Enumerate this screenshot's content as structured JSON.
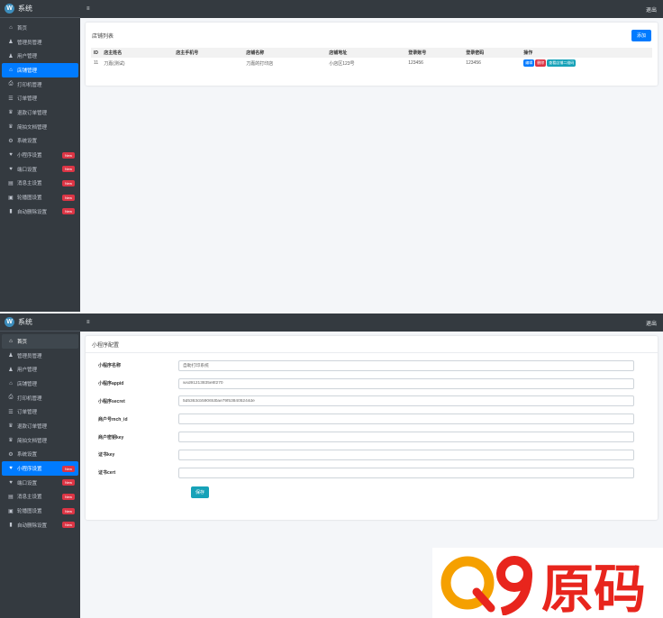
{
  "brand": "系统",
  "logout": "退出",
  "top": {
    "nav": [
      {
        "icon": "⌂",
        "label": "首页"
      },
      {
        "icon": "♟",
        "label": "管理员管理"
      },
      {
        "icon": "♟",
        "label": "用户管理"
      },
      {
        "icon": "⌂",
        "label": "店铺管理",
        "active": true
      },
      {
        "icon": "⎙",
        "label": "打印机管理"
      },
      {
        "icon": "☰",
        "label": "订单管理"
      },
      {
        "icon": "♛",
        "label": "退款订单管理"
      },
      {
        "icon": "♛",
        "label": "简拍文档管理"
      },
      {
        "icon": "⚙",
        "label": "系统设置"
      },
      {
        "icon": "♥",
        "label": "小程序设置",
        "badge": "New"
      },
      {
        "icon": "♥",
        "label": "端口设置",
        "badge": "New"
      },
      {
        "icon": "▤",
        "label": "消息主设置",
        "badge": "New"
      },
      {
        "icon": "▣",
        "label": "轮播图设置",
        "badge": "New"
      },
      {
        "icon": "▮",
        "label": "自动删除设置",
        "badge": "New"
      }
    ],
    "card_title": "店铺列表",
    "add_button": "添加",
    "table": {
      "headers": [
        "ID",
        "店主姓名",
        "店主手机号",
        "店铺名称",
        "店铺地址",
        "登录账号",
        "登录密码",
        "操作"
      ],
      "rows": [
        [
          "11",
          "刀嘉(测试)",
          "",
          "刀嘉的打印店",
          "小店区123号",
          "123456",
          "123456"
        ]
      ],
      "actions": [
        "编辑",
        "删除",
        "查看店铺二维码"
      ]
    }
  },
  "bottom": {
    "nav": [
      {
        "icon": "⌂",
        "label": "首页",
        "highlight": true
      },
      {
        "icon": "♟",
        "label": "管理员管理"
      },
      {
        "icon": "♟",
        "label": "用户管理"
      },
      {
        "icon": "⌂",
        "label": "店铺管理"
      },
      {
        "icon": "⎙",
        "label": "打印机管理"
      },
      {
        "icon": "☰",
        "label": "订单管理"
      },
      {
        "icon": "♛",
        "label": "退款订单管理"
      },
      {
        "icon": "♛",
        "label": "简拍文档管理"
      },
      {
        "icon": "⚙",
        "label": "系统设置"
      },
      {
        "icon": "♥",
        "label": "小程序设置",
        "badge": "New",
        "active": true
      },
      {
        "icon": "♥",
        "label": "端口设置",
        "badge": "New"
      },
      {
        "icon": "▤",
        "label": "消息主设置",
        "badge": "New"
      },
      {
        "icon": "▣",
        "label": "轮播图设置",
        "badge": "New"
      },
      {
        "icon": "▮",
        "label": "自动删除设置",
        "badge": "New"
      }
    ],
    "card_title": "小程序配置",
    "fields": [
      {
        "label": "小程序名称",
        "value": "自助打印系统"
      },
      {
        "label": "小程序appid",
        "value": "wxd9121383​5e8f270"
      },
      {
        "label": "小程序secret",
        "value": "5d5363cb5906fd0ae79f538405244de"
      },
      {
        "label": "商户号mch_id",
        "value": ""
      },
      {
        "label": "商户密钥key",
        "value": ""
      },
      {
        "label": "证书key",
        "value": ""
      },
      {
        "label": "证书cert",
        "value": ""
      }
    ],
    "save_button": "保存"
  },
  "watermark": "Q9原码",
  "colors": {
    "sidebar": "#343a40",
    "primary": "#007bff",
    "danger": "#dc3545",
    "info": "#17a2b8",
    "watermark_orange": "#f5a000",
    "watermark_red": "#e8251d"
  }
}
